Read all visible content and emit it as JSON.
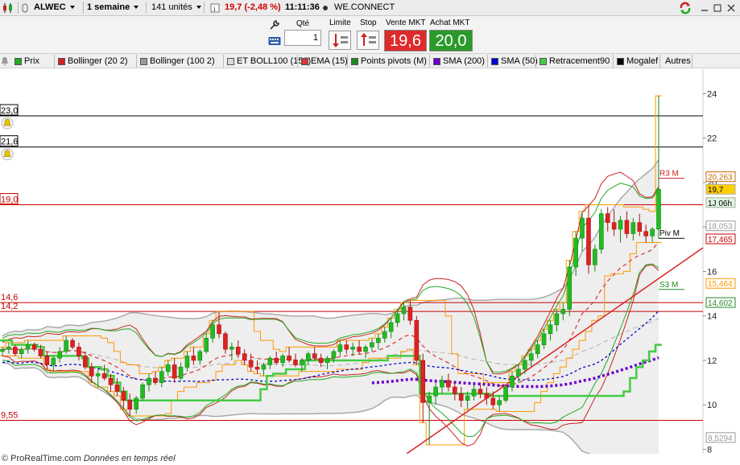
{
  "toolbar": {
    "symbol": "ALWEC",
    "period": "1 semaine",
    "units": "141 unités",
    "quote": "19,7 (-2,48 %)",
    "time": "11:11:36",
    "name": "WE.CONNECT"
  },
  "order": {
    "qty_label": "Qté",
    "qty_value": "1",
    "limit_label": "Limite",
    "stop_label": "Stop",
    "sell_label": "Vente MKT",
    "buy_label": "Achat MKT",
    "sell_price": "19,6",
    "buy_price": "20,0"
  },
  "legend": [
    {
      "label": "Prix",
      "color": "#22aa22"
    },
    {
      "label": "Bollinger (20 2)",
      "color": "#cc2222"
    },
    {
      "label": "Bollinger (100 2)",
      "color": "#9a9a9a"
    },
    {
      "label": "ET BOLL100 (150)",
      "color": "#d8d8d8"
    },
    {
      "label": "EMA (15)",
      "color": "#dd3333"
    },
    {
      "label": "Points pivots (M)",
      "color": "#228822"
    },
    {
      "label": "SMA (200)",
      "color": "#6a00cc"
    },
    {
      "label": "SMA (50)",
      "color": "#0000cc"
    },
    {
      "label": "Retracement90",
      "color": "#44cc44"
    },
    {
      "label": "Mogalef",
      "color": "#000000"
    },
    {
      "label": "Autres",
      "color": ""
    }
  ],
  "chart_data": {
    "type": "candlestick",
    "y_ticks": [
      "24",
      "22",
      "20",
      "18",
      "16",
      "14",
      "12",
      "10",
      "8"
    ],
    "ylim": [
      7.8,
      25.1
    ],
    "horizontal_levels": [
      {
        "label": "23,0",
        "value": 23.0,
        "color": "#000000"
      },
      {
        "label": "21,6",
        "value": 21.6,
        "color": "#000000"
      },
      {
        "label": "19,0",
        "value": 19.0,
        "color": "#cc0000"
      },
      {
        "label": "14,6",
        "value": 14.6,
        "color": "#cc0000"
      },
      {
        "label": "14,2",
        "value": 14.2,
        "color": "#cc0000"
      },
      {
        "label": "9,55",
        "value": 9.3,
        "color": "#cc0000"
      }
    ],
    "pivots": [
      {
        "label": "R3 M",
        "value": 20.3
      },
      {
        "label": "Piv M",
        "value": 17.6
      },
      {
        "label": "S3 M",
        "value": 15.3
      }
    ],
    "right_tags": [
      {
        "label": "20,263",
        "value": 20.263,
        "color": "#cc6600"
      },
      {
        "label": "19,7",
        "value": 19.7,
        "color": "#ffd000"
      },
      {
        "label": "1J 06h",
        "value": 19.1,
        "color": "#dff5df"
      },
      {
        "label": "18,053",
        "value": 18.053,
        "color": "#999999"
      },
      {
        "label": "17,465",
        "value": 17.465,
        "color": "#cc0000"
      },
      {
        "label": "15,464",
        "value": 15.464,
        "color": "#ff9900"
      },
      {
        "label": "14,602",
        "value": 14.602,
        "color": "#228822"
      },
      {
        "label": "8,5294",
        "value": 8.5294,
        "color": "#999999"
      }
    ],
    "candles": [
      [
        12.4,
        12.6,
        12.2,
        12.5
      ],
      [
        12.5,
        12.8,
        12.3,
        12.6
      ],
      [
        12.6,
        12.7,
        12.2,
        12.3
      ],
      [
        12.3,
        12.6,
        12.1,
        12.5
      ],
      [
        12.5,
        12.9,
        12.3,
        12.7
      ],
      [
        12.7,
        12.8,
        12.4,
        12.5
      ],
      [
        12.5,
        12.7,
        12.1,
        12.2
      ],
      [
        12.2,
        12.4,
        11.6,
        11.8
      ],
      [
        11.8,
        12.2,
        11.5,
        12.1
      ],
      [
        12.1,
        12.6,
        11.9,
        12.4
      ],
      [
        12.4,
        13.1,
        12.3,
        12.9
      ],
      [
        12.9,
        13.0,
        12.5,
        12.6
      ],
      [
        12.6,
        12.8,
        12.0,
        12.2
      ],
      [
        12.2,
        12.4,
        11.6,
        11.7
      ],
      [
        11.7,
        11.9,
        11.0,
        11.3
      ],
      [
        11.3,
        11.6,
        10.8,
        11.4
      ],
      [
        11.4,
        11.8,
        11.1,
        11.2
      ],
      [
        11.2,
        11.4,
        10.6,
        10.9
      ],
      [
        10.9,
        11.2,
        10.4,
        10.6
      ],
      [
        10.6,
        10.8,
        9.8,
        10.2
      ],
      [
        10.2,
        10.5,
        9.5,
        9.8
      ],
      [
        9.8,
        10.4,
        9.6,
        10.3
      ],
      [
        10.3,
        11.0,
        10.2,
        10.9
      ],
      [
        10.9,
        11.4,
        10.6,
        11.2
      ],
      [
        11.2,
        11.5,
        10.9,
        11.0
      ],
      [
        11.0,
        11.7,
        10.8,
        11.5
      ],
      [
        11.5,
        12.0,
        11.3,
        11.8
      ],
      [
        11.8,
        12.1,
        11.0,
        11.2
      ],
      [
        11.2,
        11.9,
        11.1,
        11.7
      ],
      [
        11.7,
        12.4,
        11.5,
        12.2
      ],
      [
        12.2,
        12.6,
        11.8,
        12.0
      ],
      [
        12.0,
        12.5,
        11.8,
        12.4
      ],
      [
        12.4,
        13.2,
        12.3,
        13.0
      ],
      [
        13.0,
        13.8,
        12.8,
        13.6
      ],
      [
        13.6,
        14.2,
        13.0,
        13.2
      ],
      [
        13.2,
        13.3,
        12.3,
        12.5
      ],
      [
        12.5,
        12.8,
        12.0,
        12.6
      ],
      [
        12.6,
        12.9,
        12.1,
        12.3
      ],
      [
        12.3,
        12.5,
        11.8,
        12.0
      ],
      [
        12.0,
        12.3,
        11.5,
        11.7
      ],
      [
        11.7,
        12.0,
        11.4,
        11.6
      ],
      [
        11.6,
        11.9,
        11.3,
        11.8
      ],
      [
        11.8,
        12.2,
        11.6,
        12.1
      ],
      [
        12.1,
        12.4,
        11.8,
        11.9
      ],
      [
        11.9,
        12.3,
        11.7,
        12.2
      ],
      [
        12.2,
        12.6,
        11.9,
        12.0
      ],
      [
        12.0,
        12.3,
        11.7,
        11.8
      ],
      [
        11.8,
        12.1,
        11.5,
        12.0
      ],
      [
        12.0,
        12.4,
        11.8,
        12.3
      ],
      [
        12.3,
        12.6,
        12.0,
        12.1
      ],
      [
        12.1,
        12.3,
        11.7,
        11.9
      ],
      [
        11.9,
        12.2,
        11.6,
        12.1
      ],
      [
        12.1,
        12.5,
        11.9,
        12.4
      ],
      [
        12.4,
        12.9,
        12.2,
        12.7
      ],
      [
        12.7,
        12.9,
        12.3,
        12.5
      ],
      [
        12.5,
        12.8,
        12.2,
        12.6
      ],
      [
        12.6,
        12.9,
        12.3,
        12.4
      ],
      [
        12.4,
        12.7,
        12.1,
        12.6
      ],
      [
        12.6,
        13.0,
        12.4,
        12.8
      ],
      [
        12.8,
        13.2,
        12.5,
        13.0
      ],
      [
        13.0,
        13.5,
        12.8,
        13.3
      ],
      [
        13.3,
        13.9,
        13.0,
        13.7
      ],
      [
        13.7,
        14.3,
        13.5,
        14.1
      ],
      [
        14.1,
        14.6,
        13.8,
        14.4
      ],
      [
        14.4,
        14.7,
        13.6,
        13.8
      ],
      [
        13.8,
        14.0,
        11.8,
        12.0
      ],
      [
        12.0,
        12.3,
        9.2,
        10.1
      ],
      [
        10.1,
        10.6,
        8.2,
        10.4
      ],
      [
        10.4,
        11.0,
        10.0,
        10.8
      ],
      [
        10.8,
        11.3,
        10.5,
        11.1
      ],
      [
        11.1,
        11.4,
        10.6,
        10.8
      ],
      [
        10.8,
        11.0,
        10.2,
        10.5
      ],
      [
        10.5,
        10.8,
        9.9,
        10.2
      ],
      [
        10.2,
        10.6,
        9.8,
        10.4
      ],
      [
        10.4,
        10.9,
        10.2,
        10.7
      ],
      [
        10.7,
        11.0,
        10.3,
        10.5
      ],
      [
        10.5,
        10.8,
        10.0,
        10.3
      ],
      [
        10.3,
        10.6,
        9.8,
        10.0
      ],
      [
        10.0,
        10.4,
        9.7,
        10.2
      ],
      [
        10.2,
        10.9,
        10.1,
        10.8
      ],
      [
        10.8,
        11.5,
        10.6,
        11.3
      ],
      [
        11.3,
        11.8,
        11.0,
        11.6
      ],
      [
        11.6,
        12.2,
        11.4,
        12.0
      ],
      [
        12.0,
        12.5,
        11.7,
        12.3
      ],
      [
        12.3,
        12.9,
        12.1,
        12.7
      ],
      [
        12.7,
        13.4,
        12.5,
        13.2
      ],
      [
        13.2,
        13.8,
        12.9,
        13.6
      ],
      [
        13.6,
        14.3,
        13.3,
        14.1
      ],
      [
        14.1,
        14.6,
        13.8,
        14.3
      ],
      [
        14.3,
        16.5,
        14.0,
        16.2
      ],
      [
        16.2,
        17.8,
        15.8,
        17.5
      ],
      [
        17.5,
        18.7,
        16.9,
        18.4
      ],
      [
        18.4,
        19.0,
        15.9,
        16.3
      ],
      [
        16.3,
        17.2,
        16.0,
        17.0
      ],
      [
        17.0,
        18.8,
        16.8,
        18.6
      ],
      [
        18.6,
        18.9,
        17.8,
        18.2
      ],
      [
        18.2,
        18.8,
        17.6,
        17.9
      ],
      [
        17.9,
        18.5,
        17.3,
        18.3
      ],
      [
        18.3,
        18.7,
        17.5,
        17.7
      ],
      [
        17.7,
        18.4,
        17.4,
        18.2
      ],
      [
        18.2,
        18.6,
        17.6,
        17.8
      ],
      [
        17.8,
        18.1,
        17.3,
        17.6
      ],
      [
        17.6,
        18.0,
        17.3,
        17.9
      ],
      [
        17.9,
        23.9,
        17.5,
        19.7
      ]
    ]
  },
  "footer": {
    "brand": "© ProRealTime.com",
    "note": "Données en temps réel"
  }
}
